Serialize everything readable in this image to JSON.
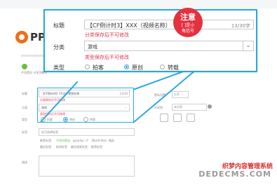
{
  "brand": {
    "logo_text": "PPS"
  },
  "progress": {
    "status_text": "平台提交 分享功能中"
  },
  "background_form": {
    "title_label": "标题",
    "title_value": "【CF倒计时】CF点评视频名称",
    "title_counter": "13/30",
    "title_hint": "分类保存后不可修改",
    "category_label": "分类",
    "category_value": "游戏",
    "category_hint": "类型保存后不可修改",
    "type_label": "类型",
    "type_options": [
      "拍客",
      "原创",
      "转载"
    ],
    "tags_label": "标签",
    "tags_placeholder": "仅可选择标签",
    "recommend_label": "推荐标签:",
    "recommend_tags": [
      "不用问就加",
      "ppsplay",
      "cf",
      "倒计时",
      "射击",
      "精英"
    ],
    "recent_label": "最近标签:",
    "recent_tags": [
      "新闻标签",
      "最近搜索标签",
      "推荐标签"
    ],
    "desc_label": "描述",
    "privacy_label": "隐私设置",
    "privacy_value": "公开",
    "album_label": "分享到",
    "album_value": "未分享"
  },
  "popup": {
    "title_label": "标题",
    "title_value": "【CF倒计时3】XXX（视频名称）",
    "title_counter": "13/30字",
    "title_hint": "分类保存后不可修改",
    "category_label": "分类",
    "category_value": "游戏",
    "category_hint": "类型保存后不可修改",
    "type_label": "类型",
    "type_options": [
      "拍客",
      "原创",
      "转载"
    ],
    "type_selected": "原创"
  },
  "stamp": {
    "title": "注意",
    "line1": "[ ]是小",
    "line2": "角括号"
  },
  "watermark": {
    "line1": "织梦内容管理系统",
    "line2": "DEDECMS.COM"
  },
  "colors": {
    "accent_blue": "#26a9e0",
    "warning_red": "#e0334b",
    "stamp_red": "#e5303f",
    "brand_orange": "#f06d1a",
    "progress_green": "#6bbf3c"
  }
}
